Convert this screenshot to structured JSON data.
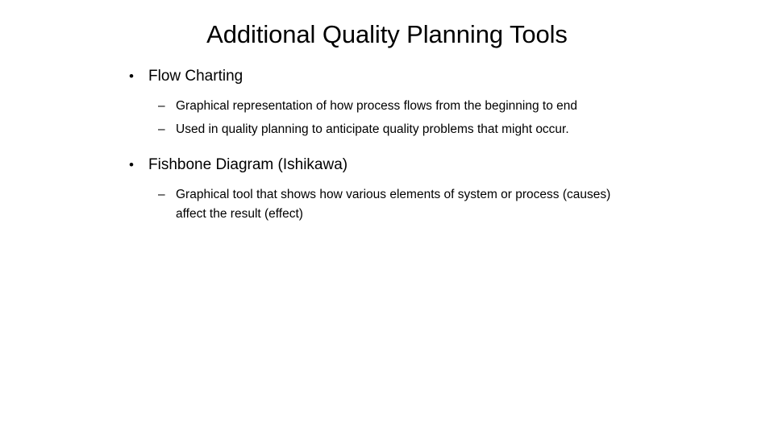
{
  "slide": {
    "title": "Additional Quality Planning Tools",
    "background_color": "#ffffff",
    "text_color": "#000000",
    "bullet_glyph_level1": "•",
    "bullet_glyph_level2": "–",
    "items": [
      {
        "label": "Flow Charting",
        "sub_items": [
          "Graphical representation of how process flows from the beginning to end",
          " Used in quality planning to anticipate quality problems that might occur."
        ]
      },
      {
        "label": "Fishbone Diagram (Ishikawa)",
        "sub_items": [
          " Graphical tool that shows how various elements of system or process (causes) affect the result (effect)"
        ]
      }
    ]
  }
}
